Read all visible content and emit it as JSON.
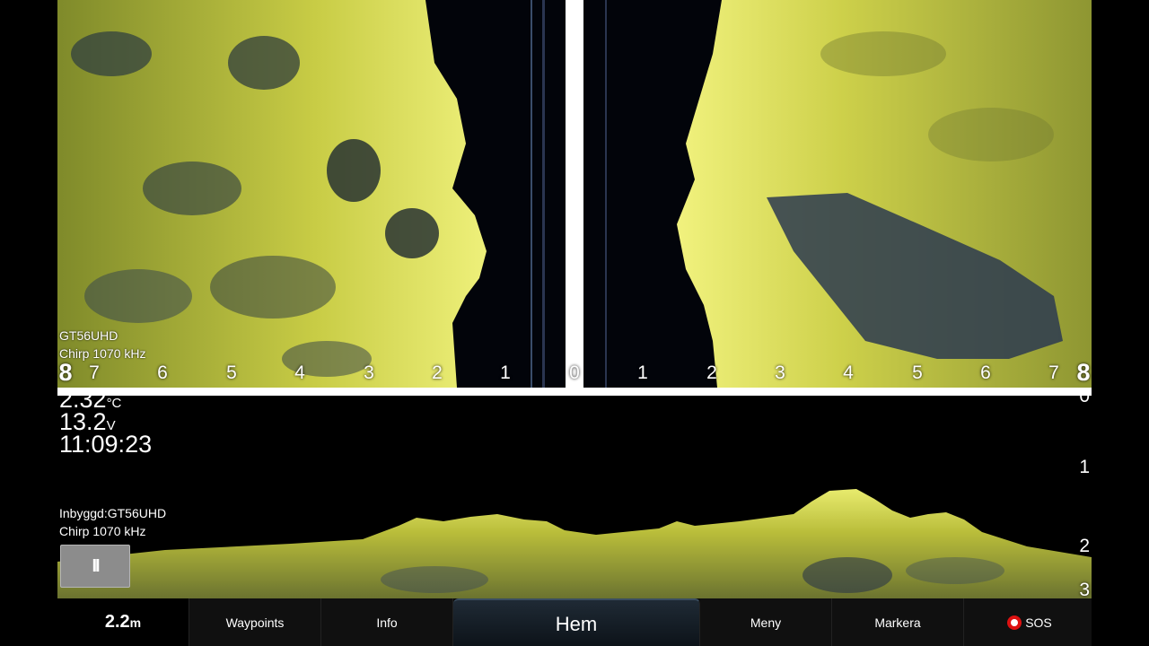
{
  "side_view": {
    "transducer": "GT56UHD",
    "frequency": "Chirp 1070 kHz",
    "range_left_edge": "8",
    "range_right_edge": "8",
    "scale_left": [
      "7",
      "6",
      "5",
      "4",
      "3",
      "2",
      "1"
    ],
    "scale_center": "0",
    "scale_right": [
      "1",
      "2",
      "3",
      "4",
      "5",
      "6",
      "7"
    ]
  },
  "readouts": {
    "temperature_value": "2.32",
    "temperature_unit": "°C",
    "voltage_value": "13.2",
    "voltage_unit": "V",
    "time": "11:09:23"
  },
  "down_view": {
    "transducer": "Inbyggd:GT56UHD",
    "frequency": "Chirp 1070 kHz",
    "depth_ticks": [
      "0",
      "1",
      "2",
      "3"
    ]
  },
  "pause_button": "II",
  "bottom_bar": {
    "depth_value": "2.2",
    "depth_unit": "m",
    "waypoints": "Waypoints",
    "info": "Info",
    "home": "Hem",
    "menu": "Meny",
    "mark": "Markera",
    "sos": "SOS"
  },
  "colors": {
    "sonar_bright": "#f2f27a",
    "sonar_mid": "#b8bb32",
    "sonar_dark": "#2d3b4f",
    "water": "#02040a"
  }
}
